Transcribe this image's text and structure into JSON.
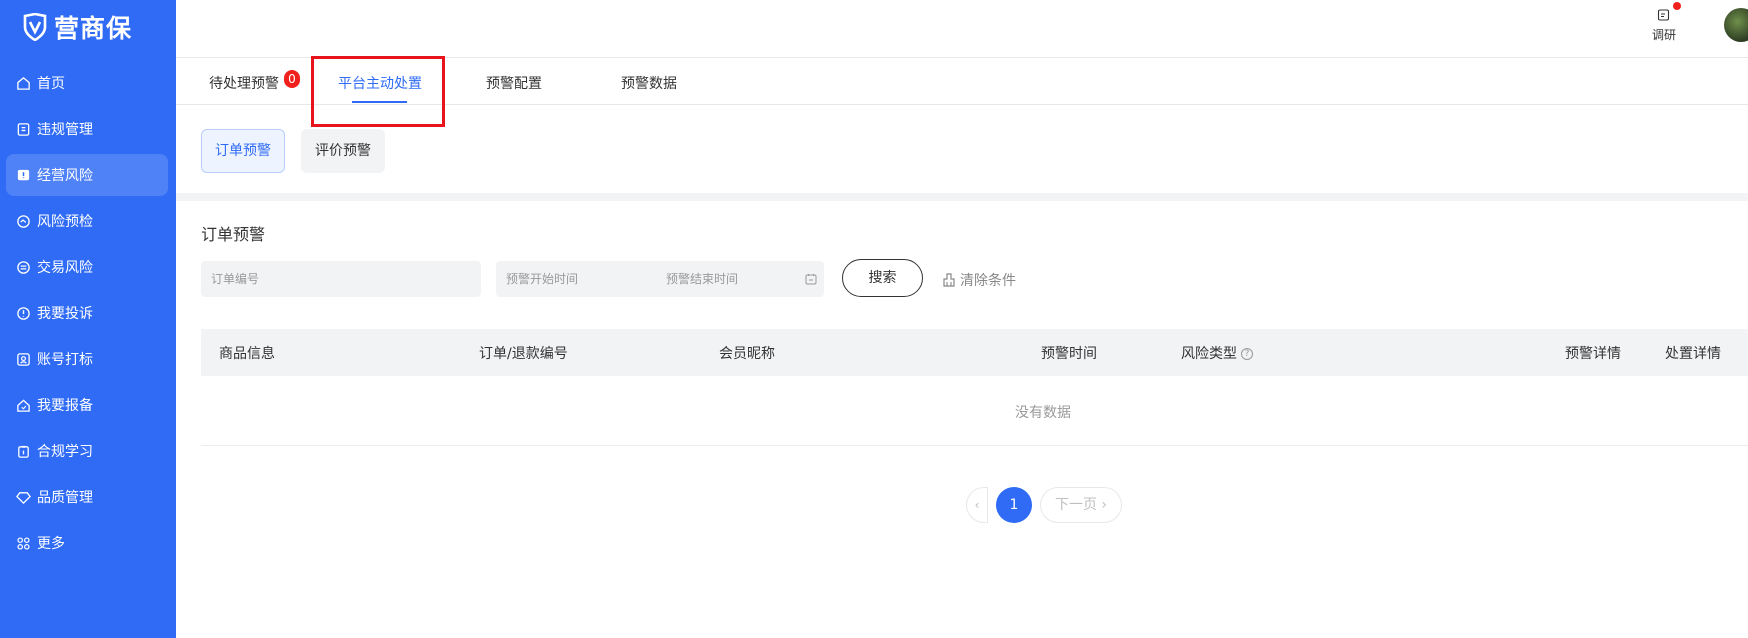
{
  "brand": {
    "name": "营商保"
  },
  "sidebar": {
    "items": [
      {
        "label": "首页",
        "icon": "home-icon"
      },
      {
        "label": "违规管理",
        "icon": "document-icon"
      },
      {
        "label": "经营风险",
        "icon": "alert-screen-icon",
        "active": true
      },
      {
        "label": "风险预检",
        "icon": "shield-check-icon"
      },
      {
        "label": "交易风险",
        "icon": "exchange-icon"
      },
      {
        "label": "我要投诉",
        "icon": "info-circle-icon"
      },
      {
        "label": "账号打标",
        "icon": "user-card-icon"
      },
      {
        "label": "我要报备",
        "icon": "house-icon"
      },
      {
        "label": "合规学习",
        "icon": "clipboard-icon"
      },
      {
        "label": "品质管理",
        "icon": "diamond-icon"
      },
      {
        "label": "更多",
        "icon": "apps-icon"
      }
    ]
  },
  "header": {
    "research_label": "调研",
    "colors": {
      "notification_dot": "#f0201c"
    }
  },
  "tabs": [
    {
      "label": "待处理预警",
      "badge": "0"
    },
    {
      "label": "平台主动处置",
      "active": true
    },
    {
      "label": "预警配置"
    },
    {
      "label": "预警数据"
    }
  ],
  "subtabs": [
    {
      "label": "订单预警",
      "active": true
    },
    {
      "label": "评价预警"
    }
  ],
  "section": {
    "title": "订单预警",
    "order_no_placeholder": "订单编号",
    "start_time_placeholder": "预警开始时间",
    "end_time_placeholder": "预警结束时间",
    "search_label": "搜索",
    "clear_label": "清除条件"
  },
  "table": {
    "columns": [
      "商品信息",
      "订单/退款编号",
      "会员昵称",
      "预警时间",
      "风险类型",
      "预警详情",
      "处置详情"
    ],
    "empty_text": "没有数据"
  },
  "pagination": {
    "prev_symbol": "‹",
    "current_page": "1",
    "next_label": "下一页 ›"
  },
  "colors": {
    "primary": "#2f6bf5",
    "highlight_box": "#e8141c"
  }
}
